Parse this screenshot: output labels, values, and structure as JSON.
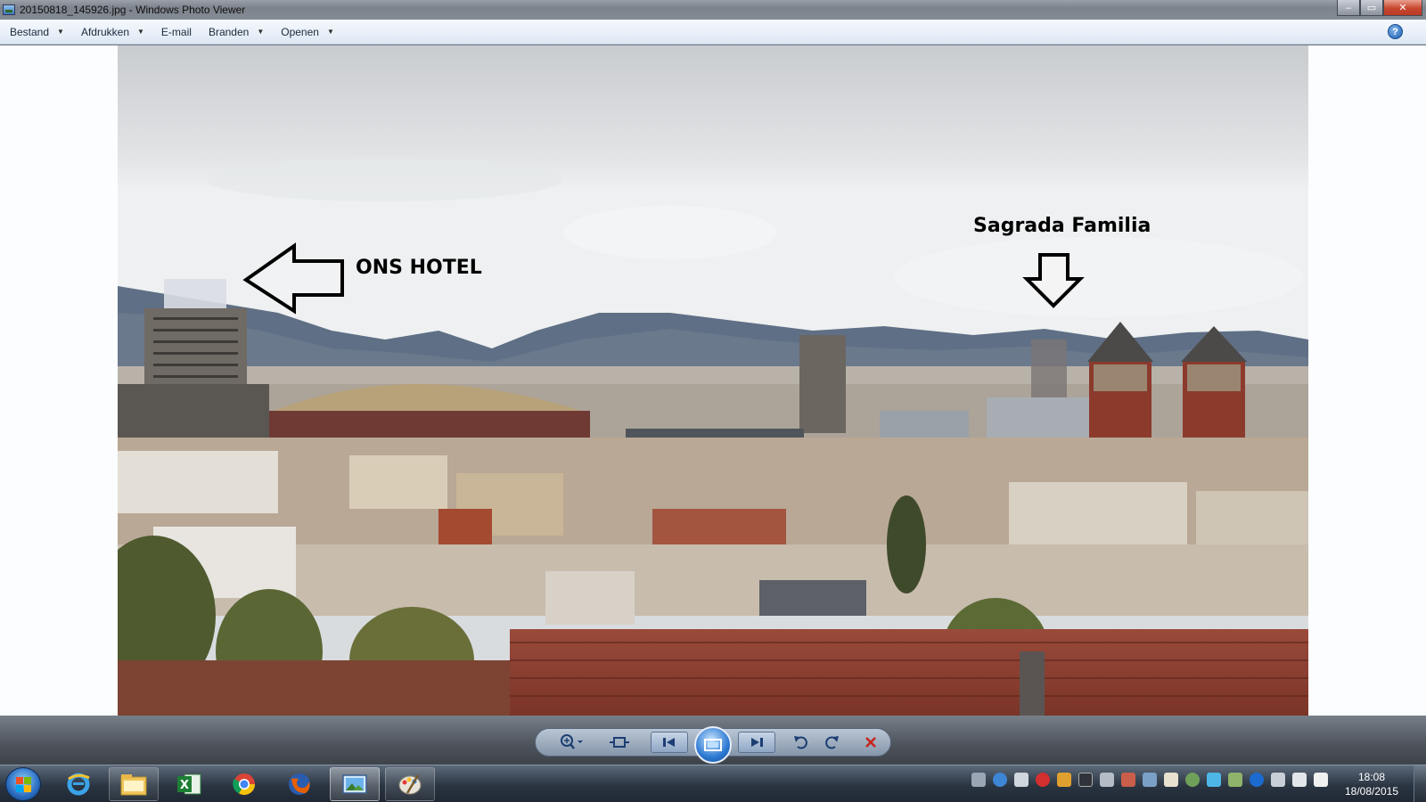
{
  "window": {
    "title": "20150818_145926.jpg - Windows Photo Viewer",
    "controls": {
      "minimize": "–",
      "restore": "▭",
      "close": "✕"
    }
  },
  "menu": {
    "items": [
      {
        "label": "Bestand",
        "dropdown": true
      },
      {
        "label": "Afdrukken",
        "dropdown": true
      },
      {
        "label": "E-mail",
        "dropdown": false
      },
      {
        "label": "Branden",
        "dropdown": true
      },
      {
        "label": "Openen",
        "dropdown": true
      }
    ],
    "help": "?"
  },
  "photo": {
    "annotations": {
      "hotel": "ONS HOTEL",
      "sagrada": "Sagrada Familia"
    }
  },
  "controls": {
    "zoom_icon": "magnifier-icon",
    "actual_size_icon": "fit-window-icon",
    "prev_icon": "previous-icon",
    "slideshow_icon": "slideshow-icon",
    "next_icon": "next-icon",
    "rotate_left_icon": "rotate-ccw-icon",
    "rotate_right_icon": "rotate-cw-icon",
    "delete_icon": "delete-icon"
  },
  "taskbar": {
    "clock_time": "18:08",
    "clock_date": "18/08/2015",
    "apps": [
      "start-icon",
      "internet-explorer-icon",
      "file-explorer-icon",
      "excel-icon",
      "chrome-icon",
      "firefox-icon",
      "photo-viewer-icon",
      "paint-icon"
    ]
  },
  "colors": {
    "accent": "#2c79d2",
    "close": "#c7462f",
    "delete": "#c8231a"
  }
}
